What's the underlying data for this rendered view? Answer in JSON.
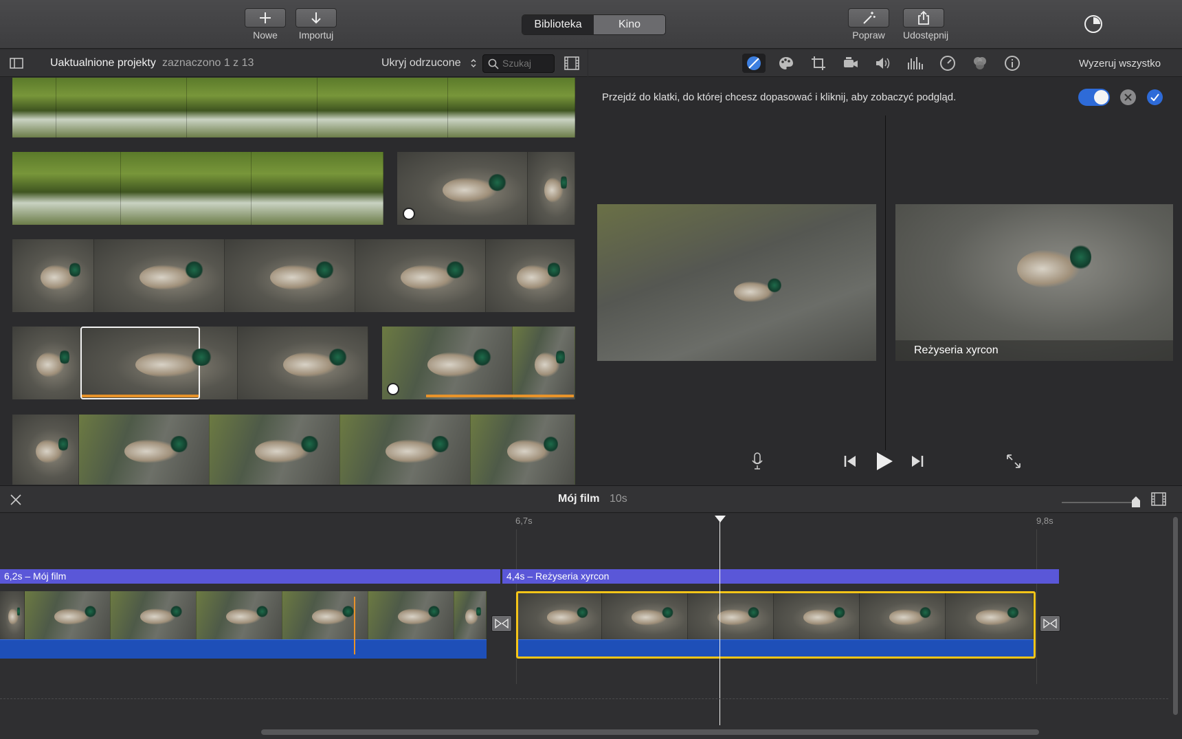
{
  "toolbar": {
    "new_label": "Nowe",
    "import_label": "Importuj",
    "segment": [
      "Biblioteka",
      "Kino"
    ],
    "enhance_label": "Popraw",
    "share_label": "Udostępnij"
  },
  "library": {
    "title": "Uaktualnione projekty",
    "selection": "zaznaczono 1 z 13",
    "filter": "Ukryj odrzucone",
    "search_placeholder": "Szukaj"
  },
  "inspector": {
    "reset_label": "Wyzeruj wszystko",
    "message": "Przejdź do klatki, do której chcesz dopasować i kliknij, aby zobaczyć podgląd.",
    "caption": "Reżyseria xyrcon"
  },
  "timeline": {
    "project_name": "Mój film",
    "duration": "10s",
    "ticks": [
      "6,7s",
      "9,8s"
    ],
    "clip1_title": "6,2s – Mój film",
    "clip2_title": "4,4s –  Reżyseria xyrcon"
  },
  "colors": {
    "accent": "#2e6bd8",
    "title_bar": "#5a57d8",
    "selection": "#f5c518",
    "audio": "#1e4fb8",
    "clip_range": "#e8932a"
  }
}
